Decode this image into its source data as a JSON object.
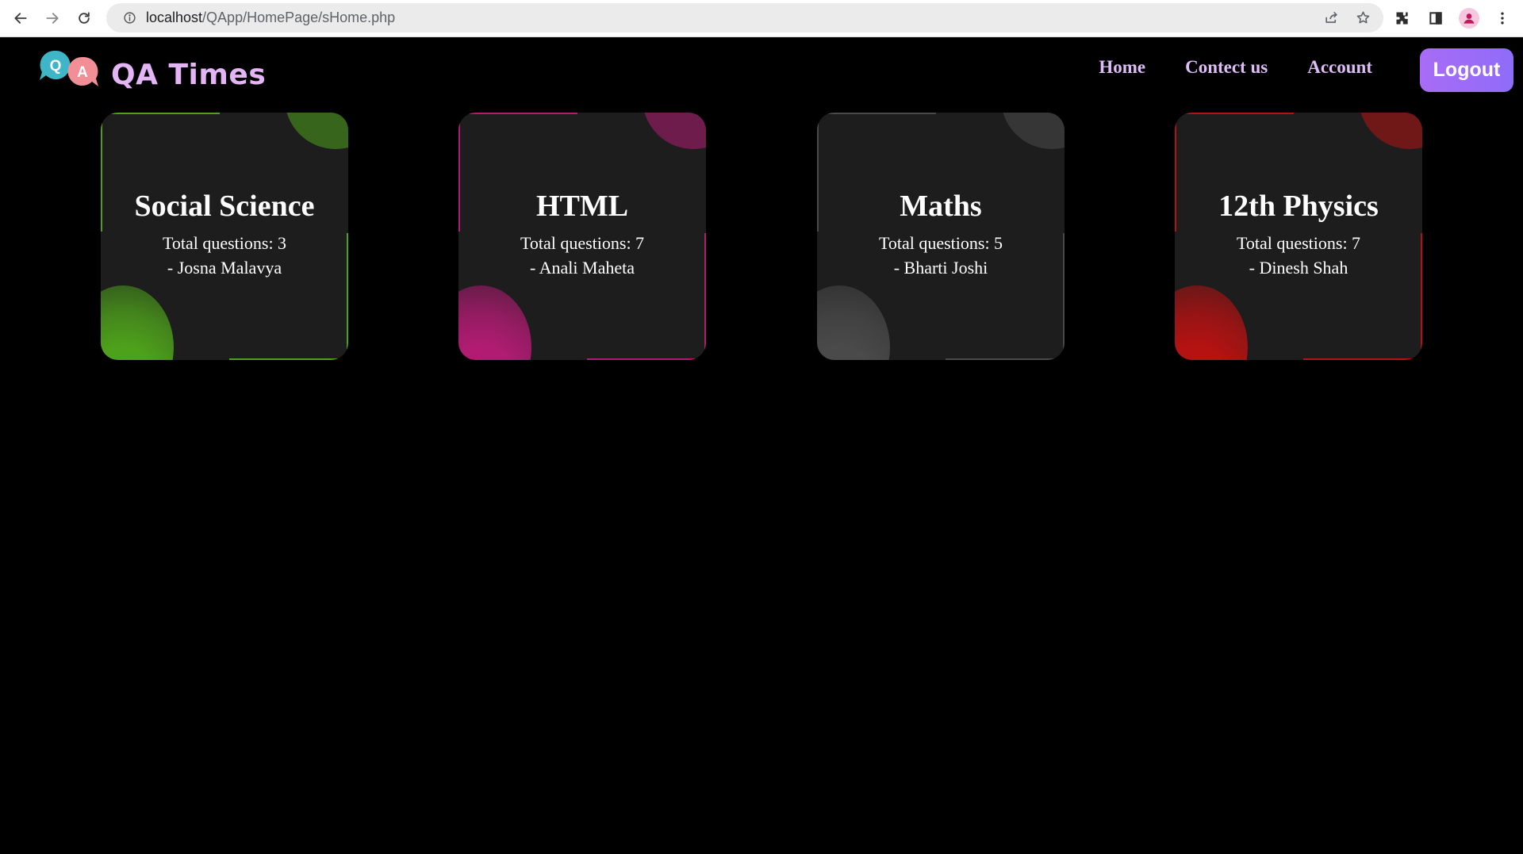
{
  "browser": {
    "url_host": "localhost",
    "url_path": "/QApp/HomePage/sHome.php"
  },
  "header": {
    "logo_letter_q": "Q",
    "logo_letter_a": "A",
    "brand": "QA Times",
    "nav": [
      "Home",
      "Contect us",
      "Account"
    ],
    "logout_label": "Logout"
  },
  "cards": [
    {
      "title": "Social Science",
      "count": "Total questions: 3",
      "author": "- Josna Malavya",
      "accent": "#4ea11b"
    },
    {
      "title": "HTML",
      "count": "Total questions: 7",
      "author": "- Anali Maheta",
      "accent": "#b11c72"
    },
    {
      "title": "Maths",
      "count": "Total questions: 5",
      "author": "- Bharti Joshi",
      "accent": "#4a4a4a"
    },
    {
      "title": "12th Physics",
      "count": "Total questions: 7",
      "author": "- Dinesh Shah",
      "accent": "#b51212"
    }
  ],
  "colors": {
    "background": "#000000",
    "card": "#1d1d1e",
    "brand": "#e4b5f5",
    "nav": "#ddbcf7",
    "logout": "#9d6cf7"
  },
  "icons": [
    "back-arrow-icon",
    "forward-arrow-icon",
    "reload-icon",
    "info-icon",
    "share-icon",
    "star-icon",
    "extensions-icon",
    "side-panel-icon",
    "profile-icon",
    "menu-dots-icon"
  ]
}
